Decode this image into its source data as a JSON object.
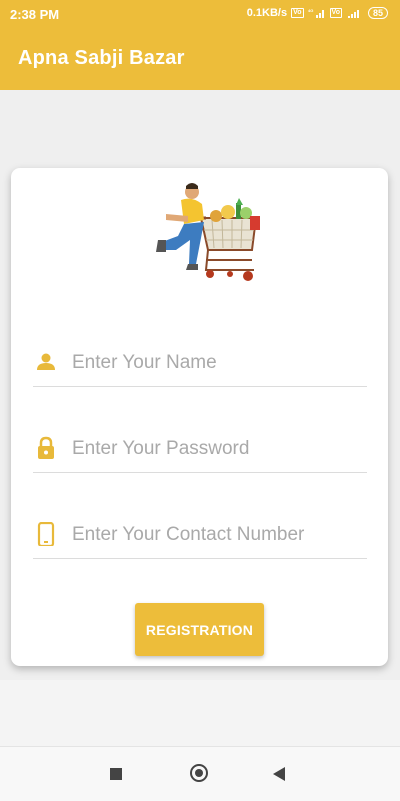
{
  "status_bar": {
    "time": "2:38 PM",
    "network_speed": "0.1KB/s",
    "volte_label": "Vo",
    "signal_label": "4G",
    "battery": "85"
  },
  "app_bar": {
    "title": "Apna Sabji Bazar"
  },
  "form": {
    "hero_image": "shopper-with-cart-illustration",
    "name_field": {
      "placeholder": "Enter Your Name",
      "value": "",
      "icon": "person-icon"
    },
    "password_field": {
      "placeholder": "Enter Your Password",
      "value": "",
      "icon": "lock-icon"
    },
    "contact_field": {
      "placeholder": "Enter Your Contact Number",
      "value": "",
      "icon": "phone-icon"
    },
    "register_button": "REGISTRATION"
  },
  "colors": {
    "primary": "#edbd3a",
    "icon": "#e8b93a",
    "hint": "#a9a9a9",
    "underline": "#dcdcdc"
  },
  "navigation_bar": {
    "buttons": [
      "recent-apps",
      "home",
      "back"
    ]
  }
}
